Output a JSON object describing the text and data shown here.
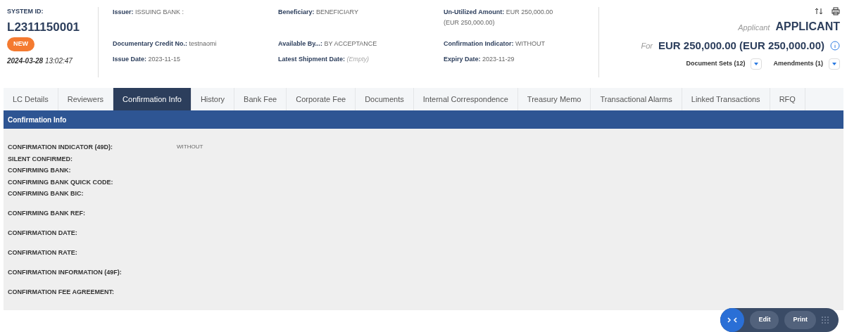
{
  "header": {
    "system_id_label": "SYSTEM ID:",
    "system_id": "L2311150001",
    "status": "NEW",
    "date": "2024-03-28",
    "time": "13:02:47",
    "columns": [
      [
        {
          "label": "Issuer:",
          "value": "ISSUING BANK :"
        },
        {
          "label": "Documentary Credit No.:",
          "value": "testnaomi"
        },
        {
          "label": "Issue Date:",
          "value": "2023-11-15"
        }
      ],
      [
        {
          "label": "Beneficiary:",
          "value": "BENEFICIARY"
        },
        {
          "label": "Available By...:",
          "value": "BY ACCEPTANCE"
        },
        {
          "label": "Latest Shipment Date:",
          "value": "(Empty)",
          "empty": true
        }
      ],
      [
        {
          "label": "Un-Utilized Amount:",
          "value": "EUR 250,000.00 (EUR 250,000.00)"
        },
        {
          "label": "Confirmation Indicator:",
          "value": "WITHOUT"
        },
        {
          "label": "Expiry Date:",
          "value": "2023-11-29"
        }
      ]
    ],
    "applicant_label": "Applicant",
    "applicant": "APPLICANT",
    "for_label": "For",
    "amount": "EUR 250,000.00 (EUR 250,000.00)",
    "dropdowns": [
      "Document Sets (12)",
      "Amendments (1)"
    ]
  },
  "tabs": [
    {
      "label": "LC Details",
      "selected": false
    },
    {
      "label": "Reviewers",
      "selected": false
    },
    {
      "label": "Confirmation Info",
      "selected": true
    },
    {
      "label": "History",
      "selected": false
    },
    {
      "label": "Bank Fee",
      "selected": false
    },
    {
      "label": "Corporate Fee",
      "selected": false
    },
    {
      "label": "Documents",
      "selected": false
    },
    {
      "label": "Internal Correspondence",
      "selected": false
    },
    {
      "label": "Treasury Memo",
      "selected": false
    },
    {
      "label": "Transactional Alarms",
      "selected": false
    },
    {
      "label": "Linked Transactions",
      "selected": false
    },
    {
      "label": "RFQ",
      "selected": false
    }
  ],
  "section_title": "Confirmation Info",
  "fields": [
    {
      "label": "CONFIRMATION INDICATOR (49D):",
      "value": "WITHOUT",
      "kind": "compact"
    },
    {
      "label": "SILENT CONFIRMED:",
      "kind": "compact"
    },
    {
      "label": "CONFIRMING BANK:",
      "kind": "compact"
    },
    {
      "label": "CONFIRMING BANK QUICK CODE:",
      "kind": "compact"
    },
    {
      "label": "CONFIRMING BANK BIC:",
      "kind": "spaced"
    },
    {
      "label": "CONFIRMING BANK REF:",
      "kind": "spaced"
    },
    {
      "label": "CONFIRMATION DATE:",
      "kind": "spaced"
    },
    {
      "label": "CONFIRMATION RATE:",
      "kind": "spaced"
    },
    {
      "label": "CONFIRMATION INFORMATION (49F):",
      "kind": "spaced"
    },
    {
      "label": "CONFIRMATION FEE AGREEMENT:",
      "kind": "compact"
    }
  ],
  "actions": [
    "Edit",
    "Print"
  ]
}
